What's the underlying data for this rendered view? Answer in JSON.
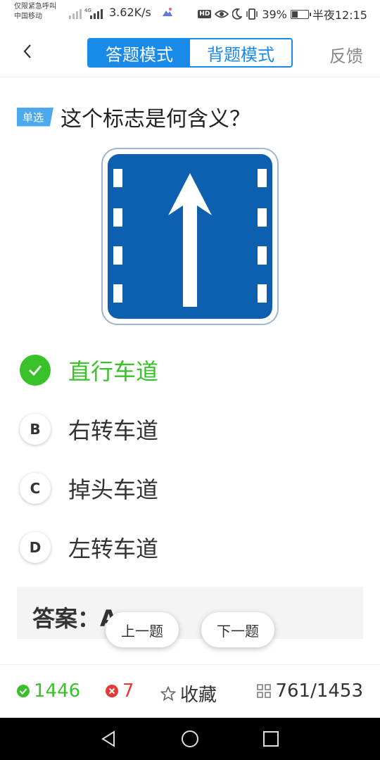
{
  "status_bar": {
    "carrier_line1": "仅限紧急呼叫",
    "carrier_line2": "中国移动",
    "speed": "3.62K/s",
    "hd": "HD",
    "battery": "39%",
    "battery_level": 0.39,
    "time": "半夜12:15"
  },
  "header": {
    "tab_answer": "答题模式",
    "tab_memorize": "背题模式",
    "feedback": "反馈"
  },
  "question": {
    "type_badge": "单选",
    "text": "这个标志是何含义？"
  },
  "options": [
    {
      "marker": "",
      "text": "直行车道",
      "correct": true
    },
    {
      "marker": "B",
      "text": "右转车道",
      "correct": false
    },
    {
      "marker": "C",
      "text": "掉头车道",
      "correct": false
    },
    {
      "marker": "D",
      "text": "左转车道",
      "correct": false
    }
  ],
  "answer": {
    "label": "答案：A"
  },
  "nav": {
    "prev": "上一题",
    "next": "下一题"
  },
  "bottom_bar": {
    "correct_count": "1446",
    "wrong_count": "7",
    "favorite": "收藏",
    "progress": "761/1453"
  },
  "colors": {
    "accent": "#1a8ae8",
    "correct": "#39c12a",
    "wrong": "#e53935",
    "sign_blue": "#0d5fb0"
  }
}
